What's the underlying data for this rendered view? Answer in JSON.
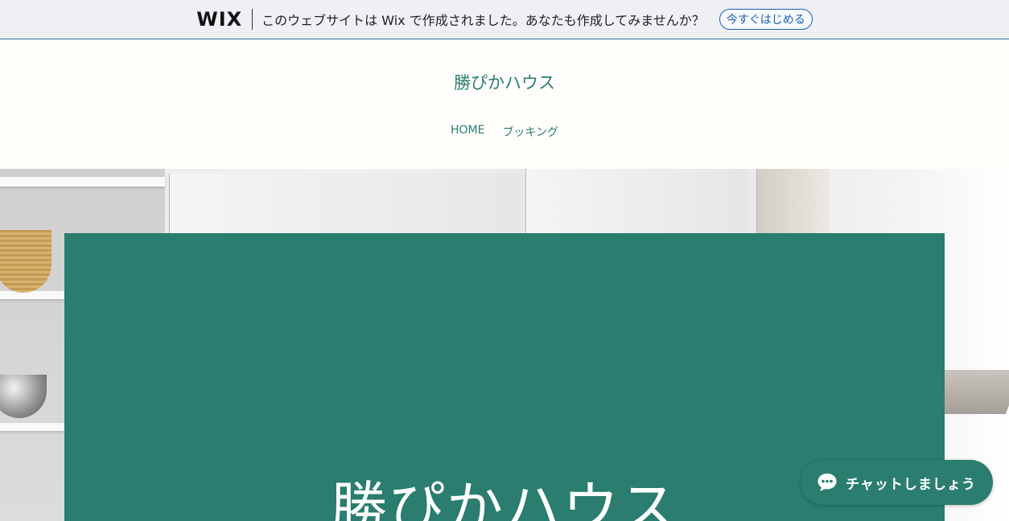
{
  "wix_banner": {
    "logo": "WIX",
    "message": "このウェブサイトは Wix で作成されました。あなたも作成してみませんか？",
    "cta_label": "今すぐはじめる"
  },
  "header": {
    "site_title": "勝ぴかハウス",
    "nav": [
      "HOME",
      "ブッキング"
    ]
  },
  "hero": {
    "title": "勝ぴかハウス"
  },
  "chat": {
    "label": "チャットしましょう",
    "icon": "chat-bubble-icon"
  },
  "colors": {
    "brand": "#2a7d6f",
    "banner_cta": "#1a5fb4"
  }
}
